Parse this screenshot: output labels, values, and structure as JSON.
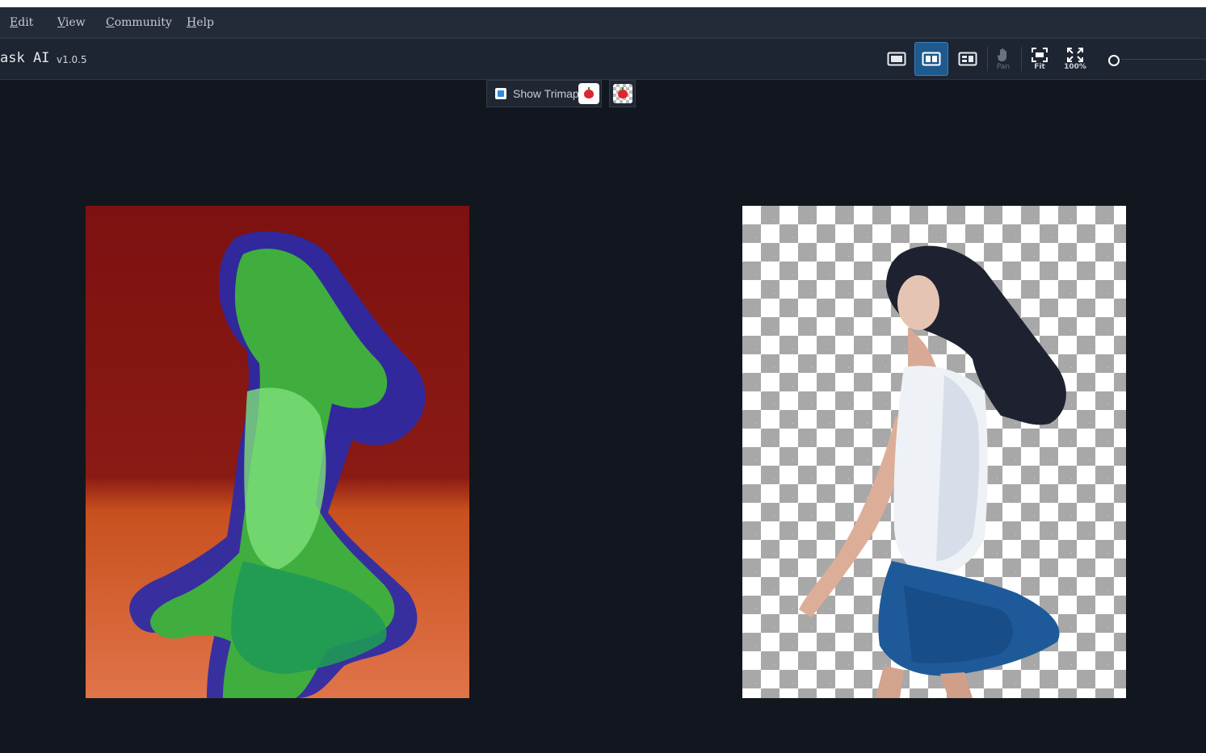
{
  "menu": {
    "items": [
      "Edit",
      "View",
      "Community",
      "Help"
    ]
  },
  "toolbar": {
    "app_title": "ask AI",
    "version": "v1.0.5",
    "pan_label": "Pan",
    "fit_label": "Fit",
    "zoom100_label": "100%",
    "active_view": "split-view",
    "icons": [
      "original-view-icon",
      "split-view-icon",
      "compare-view-icon",
      "hand-pan-icon",
      "fit-screen-icon",
      "expand-100-icon",
      "zoom-slider-knob"
    ]
  },
  "trimap": {
    "label": "Show Trimap",
    "checked": true
  },
  "colors": {
    "background": "#12171f",
    "menubar": "#232b39",
    "toolbar": "#1d2532",
    "accent": "#1e5a8e",
    "trimap_foreground": "#3ca33c",
    "trimap_unknown": "#2a2aa8",
    "trimap_background": "#8b1010"
  }
}
